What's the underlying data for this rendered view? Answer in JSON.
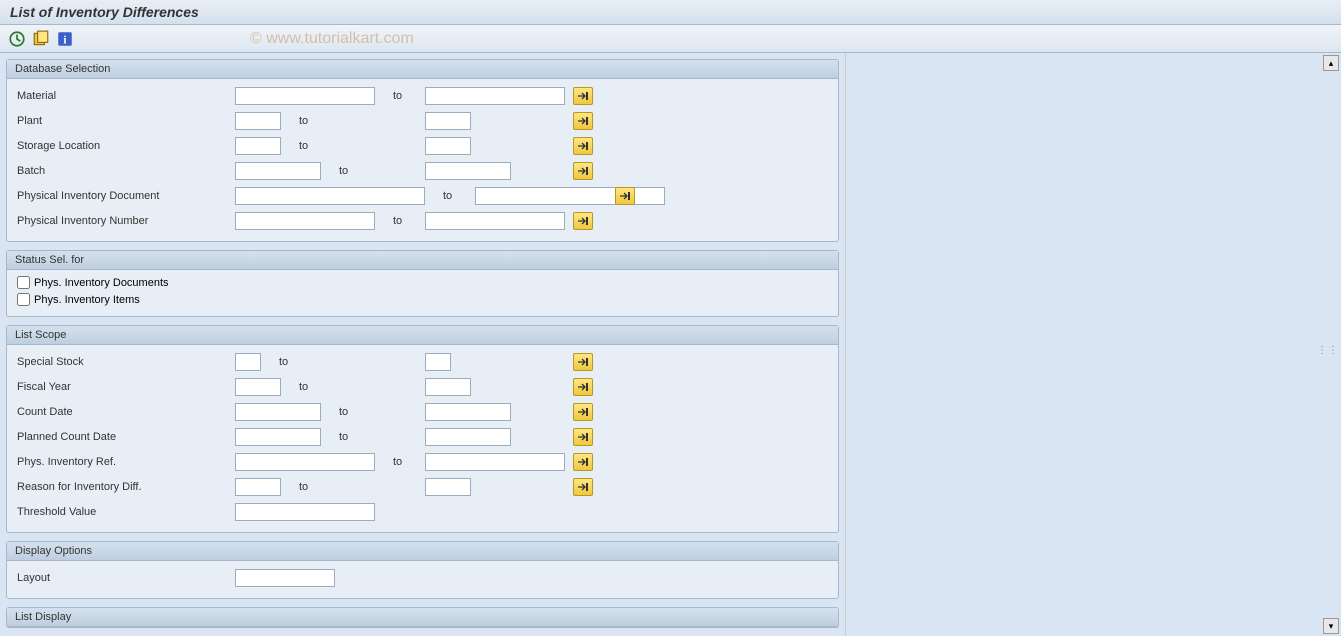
{
  "title": "List of Inventory Differences",
  "watermark": "© www.tutorialkart.com",
  "to_label": "to",
  "groups": {
    "db": {
      "title": "Database Selection",
      "material": "Material",
      "plant": "Plant",
      "storage_loc": "Storage Location",
      "batch": "Batch",
      "pi_doc": "Physical Inventory Document",
      "pi_num": "Physical Inventory Number"
    },
    "status": {
      "title": "Status Sel. for",
      "docs": "Phys. Inventory Documents",
      "items": "Phys. Inventory Items"
    },
    "scope": {
      "title": "List Scope",
      "special_stock": "Special Stock",
      "fiscal_year": "Fiscal Year",
      "count_date": "Count Date",
      "planned_date": "Planned Count Date",
      "pi_ref": "Phys. Inventory Ref.",
      "reason": "Reason for Inventory Diff.",
      "threshold": "Threshold Value"
    },
    "display_opts": {
      "title": "Display Options",
      "layout": "Layout"
    },
    "list_display": {
      "title": "List Display"
    }
  }
}
